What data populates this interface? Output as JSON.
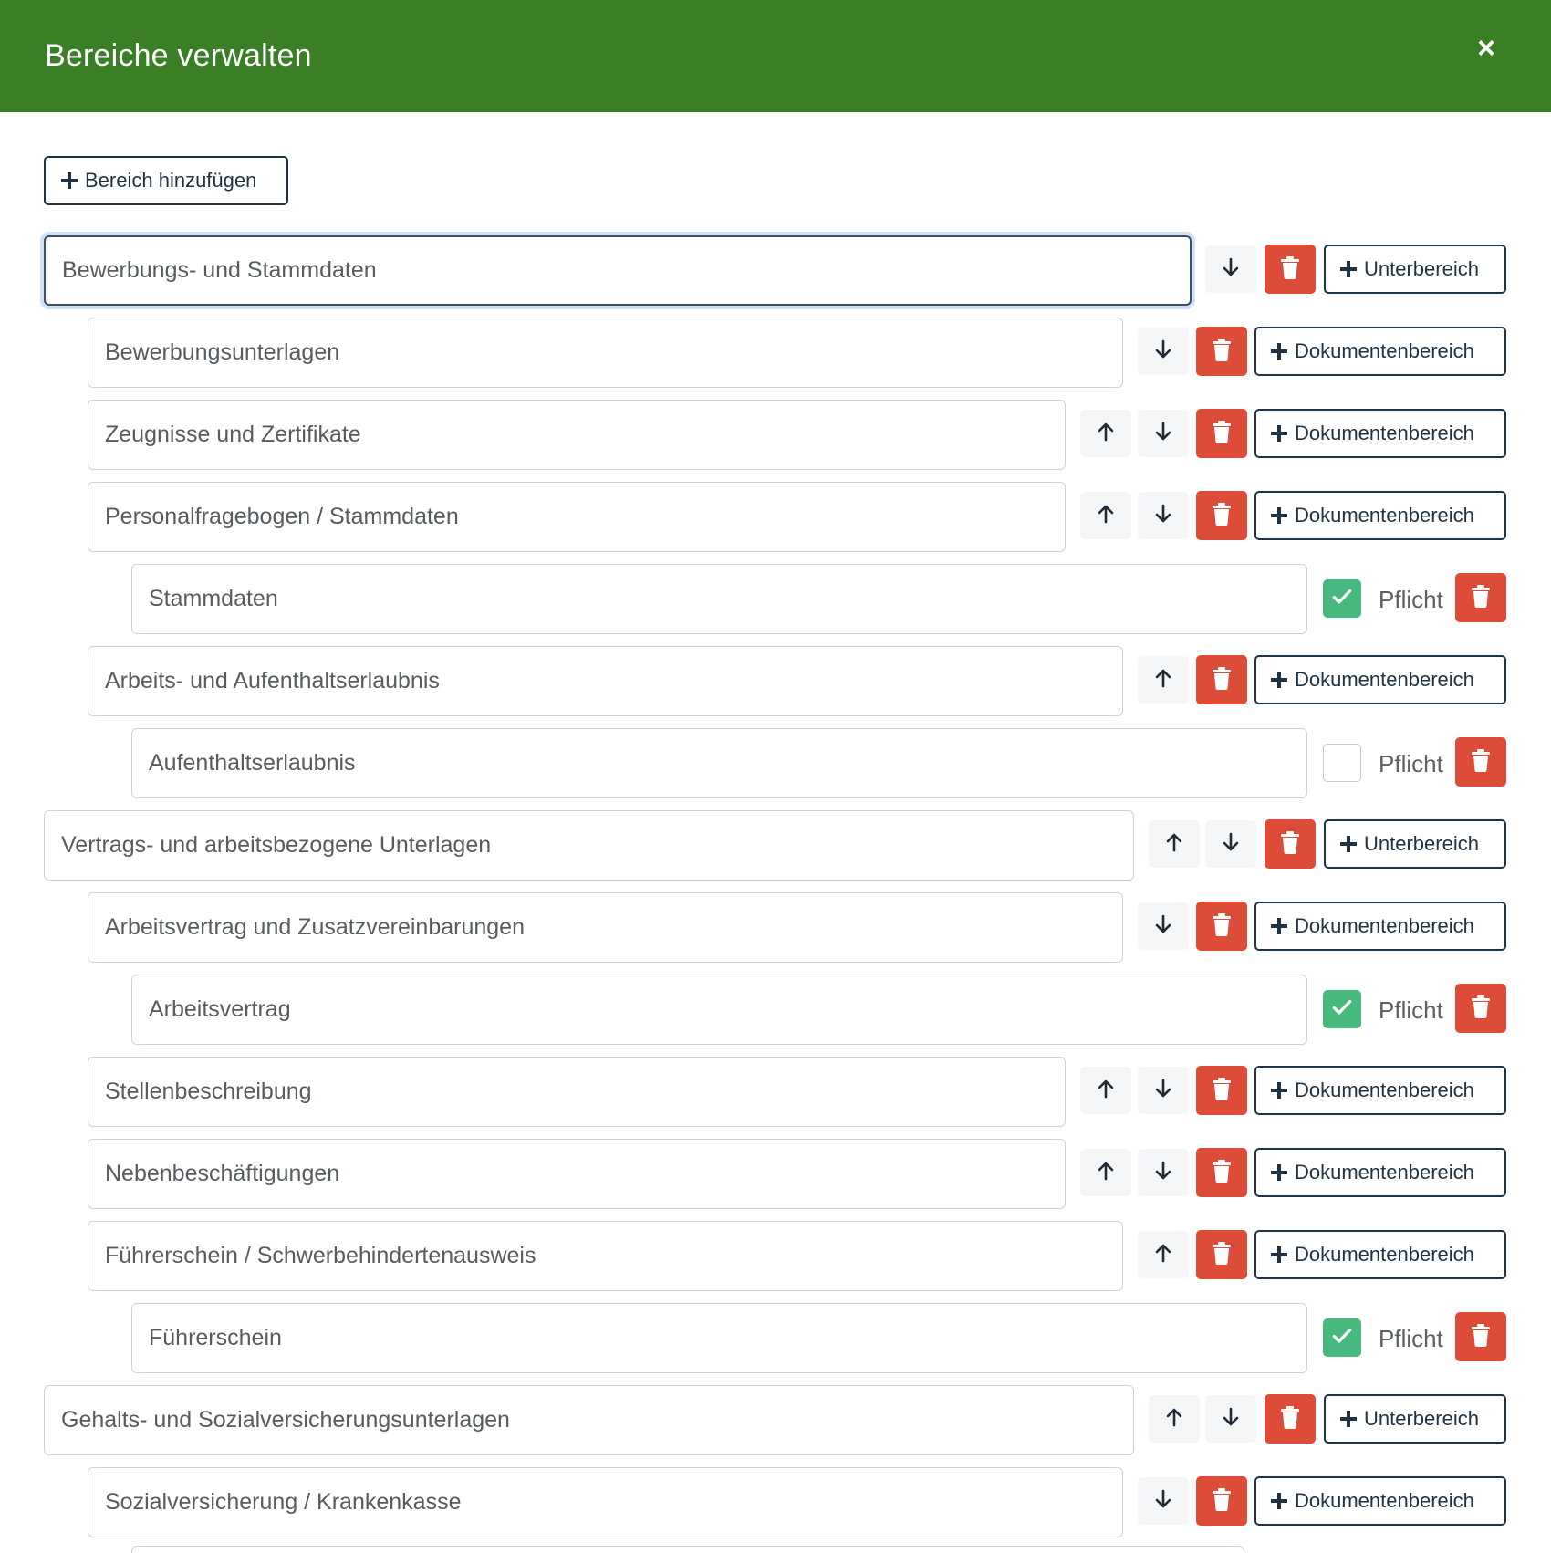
{
  "modal": {
    "title": "Bereiche verwalten",
    "close_icon": "close-icon",
    "add_area_label": "Bereich hinzufügen"
  },
  "labels": {
    "add_subarea": "Unterbereich",
    "add_document_area": "Dokumentenbereich",
    "required": "Pflicht"
  },
  "colors": {
    "header": "#3a7f25",
    "delete": "#dd4b39",
    "checked": "#47b97e"
  },
  "areas": {
    "a1": {
      "value": "Bewerbungs- und Stammdaten"
    },
    "a1s1": {
      "value": "Bewerbungsunterlagen"
    },
    "a1s2": {
      "value": "Zeugnisse und Zertifikate"
    },
    "a1s3": {
      "value": "Personalfragebogen / Stammdaten"
    },
    "a1s3d1": {
      "value": "Stammdaten",
      "required": true
    },
    "a1s4": {
      "value": "Arbeits- und Aufenthaltserlaubnis"
    },
    "a1s4d1": {
      "value": "Aufenthaltserlaubnis",
      "required": false
    },
    "a2": {
      "value": "Vertrags- und arbeitsbezogene Unterlagen"
    },
    "a2s1": {
      "value": "Arbeitsvertrag und Zusatzvereinbarungen"
    },
    "a2s1d1": {
      "value": "Arbeitsvertrag",
      "required": true
    },
    "a2s2": {
      "value": "Stellenbeschreibung"
    },
    "a2s3": {
      "value": "Nebenbeschäftigungen"
    },
    "a2s4": {
      "value": "Führerschein / Schwerbehindertenausweis"
    },
    "a2s4d1": {
      "value": "Führerschein",
      "required": true
    },
    "a3": {
      "value": "Gehalts- und Sozialversicherungsunterlagen"
    },
    "a3s1": {
      "value": "Sozialversicherung / Krankenkasse"
    }
  }
}
